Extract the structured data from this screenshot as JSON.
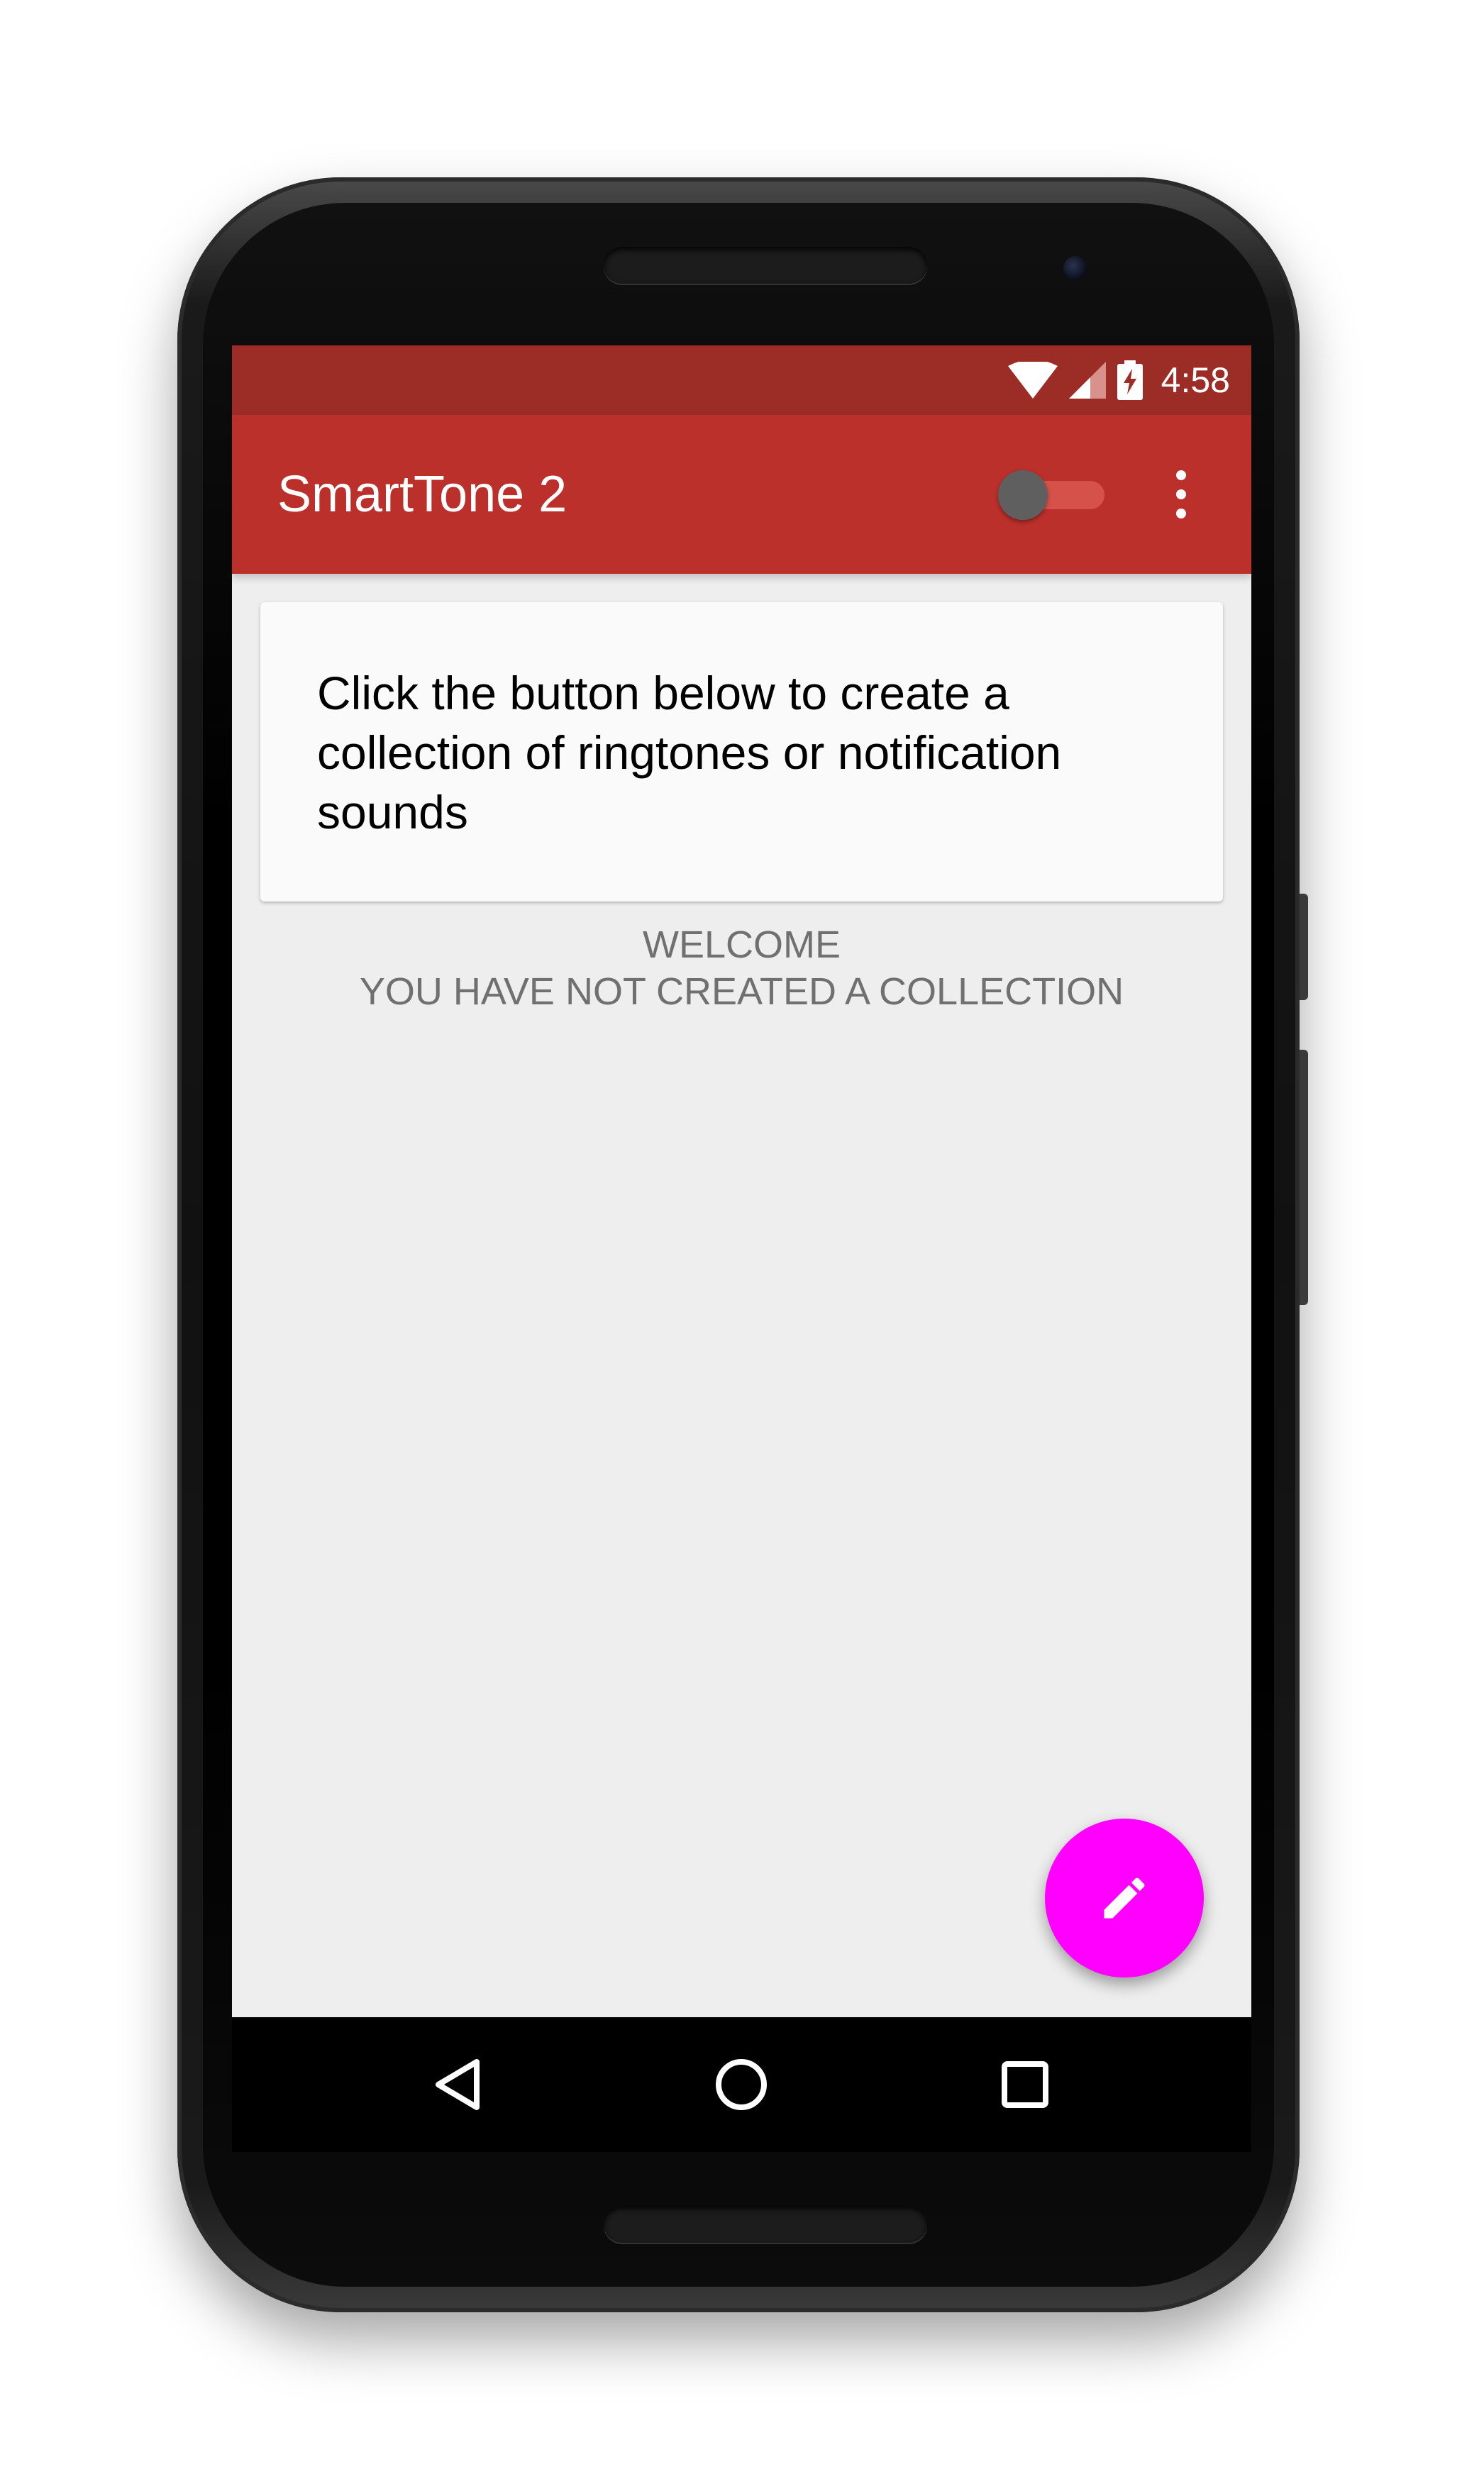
{
  "status_bar": {
    "time": "4:58",
    "icons": [
      "wifi-icon",
      "cell-signal-icon",
      "battery-charging-icon"
    ]
  },
  "toolbar": {
    "title": "SmartTone 2",
    "switch_state": "off",
    "overflow_icon": "more-vert-icon"
  },
  "card": {
    "message": "Click the button below to create a collection of ringtones or notification sounds"
  },
  "empty_state": {
    "line1": "WELCOME",
    "line2": "YOU HAVE NOT CREATED A COLLECTION"
  },
  "fab": {
    "icon": "edit-pencil-icon"
  },
  "nav_bar": {
    "buttons": [
      "back-icon",
      "home-icon",
      "recents-icon"
    ]
  },
  "colors": {
    "status_bar": "#9b2d26",
    "toolbar": "#bb302b",
    "background": "#eeeeee",
    "card": "#fafafa",
    "fab": "#ff00ff",
    "switch_track": "#d7514b",
    "switch_thumb": "#5f5f5f"
  }
}
